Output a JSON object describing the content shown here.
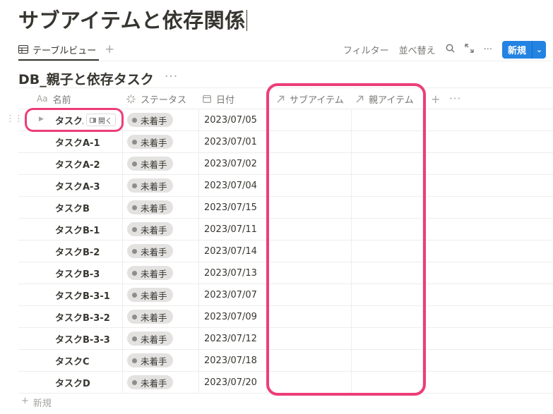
{
  "page": {
    "title": "サブアイテムと依存関係"
  },
  "view": {
    "tab_label": "テーブルビュー",
    "add_view": "+",
    "toolbar": {
      "filter": "フィルター",
      "sort": "並べ替え",
      "search_icon": "search-icon",
      "expand_icon": "expand-icon",
      "more": "···",
      "new_label": "新規",
      "new_dropdown": "⌄"
    }
  },
  "database": {
    "title": "DB_親子と依存タスク",
    "more": "···",
    "columns": [
      {
        "label": "名前",
        "icon": "Aa"
      },
      {
        "label": "ステータス",
        "icon": "status-icon"
      },
      {
        "label": "日付",
        "icon": "calendar-icon"
      },
      {
        "label": "サブアイテム",
        "icon": "relation-arrow-icon"
      },
      {
        "label": "親アイテム",
        "icon": "relation-arrow-icon"
      }
    ],
    "add_column": "+",
    "column_more": "···",
    "rows": [
      {
        "name": "タスクA",
        "status": "未着手",
        "date": "2023/07/05"
      },
      {
        "name": "タスクA-1",
        "status": "未着手",
        "date": "2023/07/01"
      },
      {
        "name": "タスクA-2",
        "status": "未着手",
        "date": "2023/07/02"
      },
      {
        "name": "タスクA-3",
        "status": "未着手",
        "date": "2023/07/04"
      },
      {
        "name": "タスクB",
        "status": "未着手",
        "date": "2023/07/15"
      },
      {
        "name": "タスクB-1",
        "status": "未着手",
        "date": "2023/07/11"
      },
      {
        "name": "タスクB-2",
        "status": "未着手",
        "date": "2023/07/14"
      },
      {
        "name": "タスクB-3",
        "status": "未着手",
        "date": "2023/07/13"
      },
      {
        "name": "タスクB-3-1",
        "status": "未着手",
        "date": "2023/07/07"
      },
      {
        "name": "タスクB-3-2",
        "status": "未着手",
        "date": "2023/07/09"
      },
      {
        "name": "タスクB-3-3",
        "status": "未着手",
        "date": "2023/07/12"
      },
      {
        "name": "タスクC",
        "status": "未着手",
        "date": "2023/07/18"
      },
      {
        "name": "タスクD",
        "status": "未着手",
        "date": "2023/07/20"
      }
    ],
    "open_label": "開く",
    "new_row": "新規"
  },
  "colors": {
    "accent": "#2383e2",
    "highlight": "#ec3e78",
    "status_pill": "#e3e2e0"
  }
}
